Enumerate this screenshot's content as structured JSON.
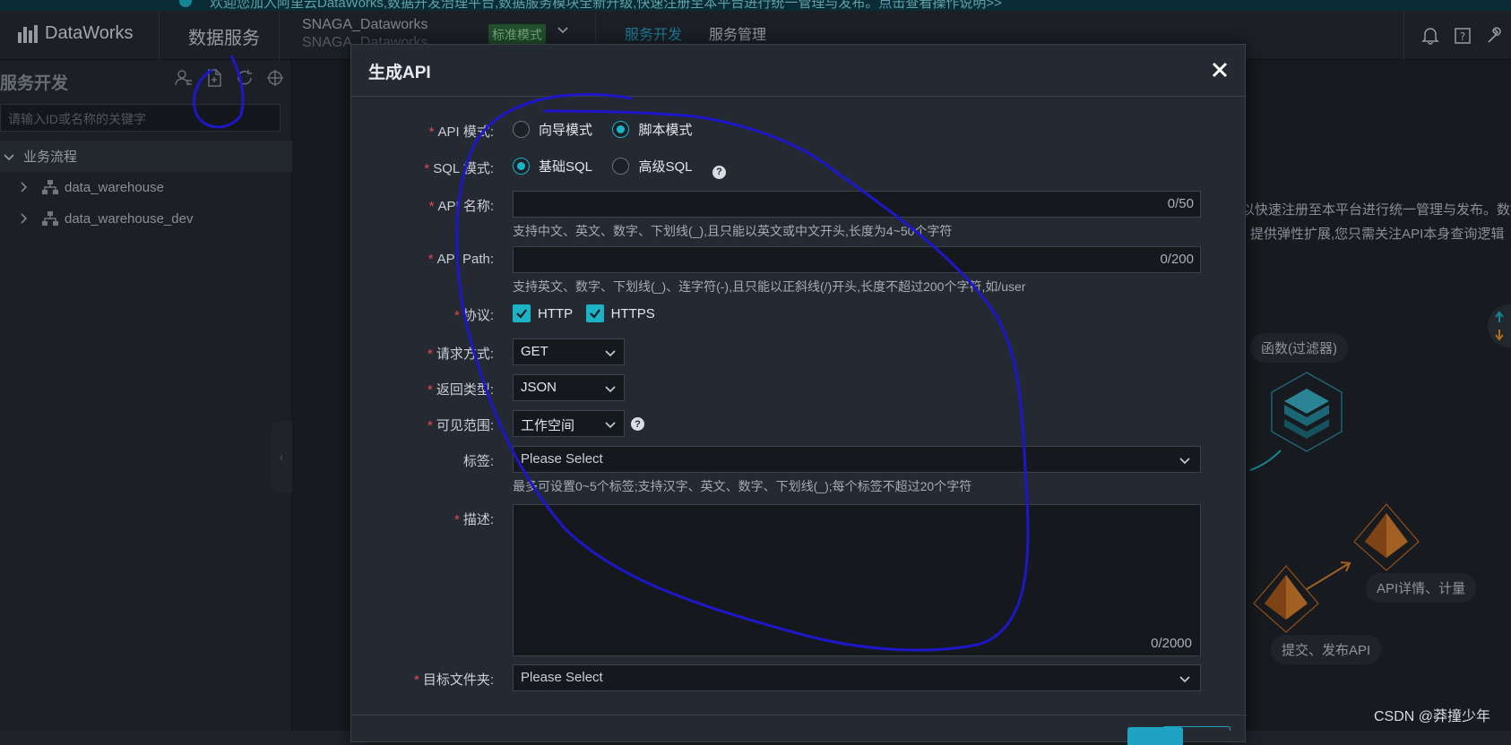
{
  "banner": {
    "text": "欢迎您加入阿里云DataWorks,数据开发治理平台,数据服务模块全新升级,快速注册至本平台进行统一管理与发布。点击查看操作说明>>"
  },
  "topnav": {
    "logo": "DataWorks",
    "product": "数据服务",
    "workspace_line1": "SNAGA_Dataworks",
    "workspace_line2": "SNAGA_Dataworks",
    "mode_badge": "标准模式",
    "tabs": [
      {
        "label": "服务开发",
        "active": true
      },
      {
        "label": "服务管理",
        "active": false
      }
    ],
    "icons": [
      "bell-icon",
      "help-icon",
      "wrench-icon"
    ]
  },
  "sidebar": {
    "title": "服务开发",
    "search_placeholder": "请输入ID或名称的关键字",
    "group": "业务流程",
    "items": [
      {
        "label": "data_warehouse"
      },
      {
        "label": "data_warehouse_dev"
      }
    ]
  },
  "background": {
    "text1": "以快速注册至本平台进行统一管理与发布。数据",
    "text2": "提供弹性扩展,您只需关注API本身查询逻辑",
    "bubble_filter": "函数(过滤器)",
    "bubble_detail": "API详情、计量",
    "bubble_publish": "提交、发布API",
    "watermark": "CSDN @莽撞少年"
  },
  "modal": {
    "title": "生成API",
    "api_mode": {
      "label": "API 模式:",
      "options": [
        "向导模式",
        "脚本模式"
      ],
      "selected": 1
    },
    "sql_mode": {
      "label": "SQL 模式:",
      "options": [
        "基础SQL",
        "高级SQL"
      ],
      "selected": 0
    },
    "api_name": {
      "label": "API 名称:",
      "counter": "0/50",
      "hint": "支持中文、英文、数字、下划线(_),且只能以英文或中文开头,长度为4~50个字符"
    },
    "api_path": {
      "label": "API Path:",
      "counter": "0/200",
      "hint": "支持英文、数字、下划线(_)、连字符(-),且只能以正斜线(/)开头,长度不超过200个字符,如/user"
    },
    "protocol": {
      "label": "协议:",
      "options": [
        "HTTP",
        "HTTPS"
      ]
    },
    "method": {
      "label": "请求方式:",
      "value": "GET"
    },
    "return_type": {
      "label": "返回类型:",
      "value": "JSON"
    },
    "visibility": {
      "label": "可见范围:",
      "value": "工作空间"
    },
    "tags": {
      "label": "标签:",
      "placeholder": "Please Select",
      "hint": "最多可设置0~5个标签;支持汉字、英文、数字、下划线(_);每个标签不超过20个字符"
    },
    "description": {
      "label": "描述:",
      "counter": "0/2000"
    },
    "target_folder": {
      "label": "目标文件夹:",
      "placeholder": "Please Select"
    }
  }
}
